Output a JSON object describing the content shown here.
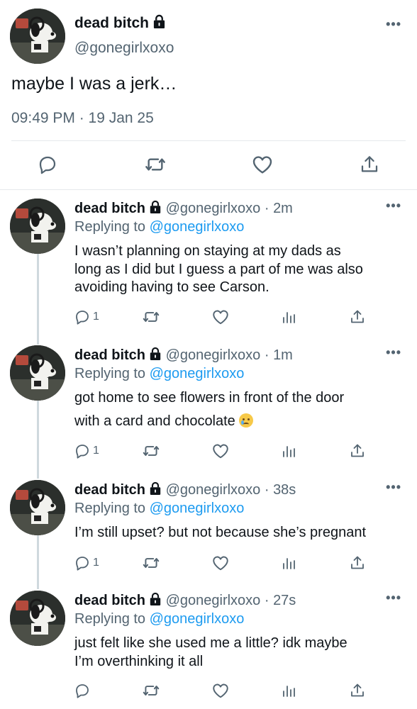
{
  "main_tweet": {
    "display_name": "dead bitch",
    "handle": "@gonegirlxoxo",
    "text": "maybe I was a jerk…",
    "timestamp": "09:49 PM · 19 Jan 25",
    "icons": [
      "reply-icon",
      "retweet-icon",
      "like-icon",
      "share-icon"
    ]
  },
  "replies": [
    {
      "display_name": "dead bitch",
      "meta": "@gonegirlxoxo · 2m",
      "replying_prefix": "Replying to ",
      "replying_to": "@gonegirlxoxo",
      "text_lines": [
        "I wasn’t planning on staying at my dads as",
        "long as I did but I guess a part of me was also",
        "avoiding having to see Carson."
      ],
      "reply_count": "1"
    },
    {
      "display_name": "dead bitch",
      "meta": "@gonegirlxoxo · 1m",
      "replying_prefix": "Replying to ",
      "replying_to": "@gonegirlxoxo",
      "text_lines": [
        "got home to see flowers in front of the door",
        "with a card and chocolate"
      ],
      "emoji": "crying-face",
      "reply_count": "1"
    },
    {
      "display_name": "dead bitch",
      "meta": "@gonegirlxoxo · 38s",
      "replying_prefix": "Replying to ",
      "replying_to": "@gonegirlxoxo",
      "text_lines": [
        "I’m still upset? but not because she’s pregnant"
      ],
      "reply_count": "1"
    },
    {
      "display_name": "dead bitch",
      "meta": "@gonegirlxoxo · 27s",
      "replying_prefix": "Replying to ",
      "replying_to": "@gonegirlxoxo",
      "text_lines": [
        "just felt like she used me a little? idk maybe",
        "I’m overthinking it all"
      ],
      "reply_count": ""
    }
  ],
  "more_label": "•••",
  "colors": {
    "link": "#1d9bf0",
    "secondary": "#536471",
    "text": "#0f1419"
  }
}
